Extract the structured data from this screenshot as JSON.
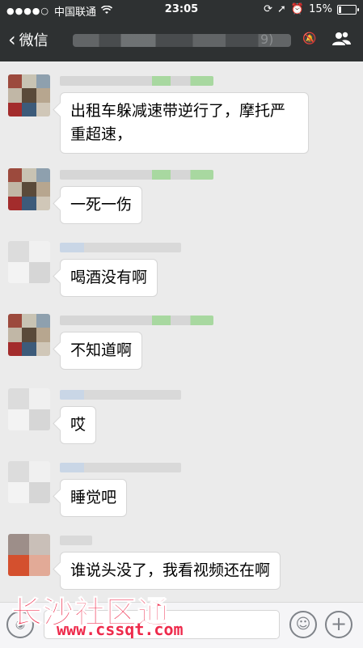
{
  "status": {
    "signal": "●●●●○",
    "carrier": "中国联通",
    "wifi_icon": "wifi-icon",
    "time": "23:05",
    "battery": "15%",
    "battery_level": 0.15
  },
  "nav": {
    "back_label": "微信",
    "title_visible_suffix": "9)"
  },
  "messages": [
    {
      "avatar": "mosaic",
      "name_style": "a",
      "text": "出租车躲减速带逆行了，摩托严重超速，"
    },
    {
      "avatar": "mosaic",
      "name_style": "a",
      "text": "一死一伤"
    },
    {
      "avatar": "light",
      "name_style": "b",
      "text": "喝酒没有啊"
    },
    {
      "avatar": "mosaic",
      "name_style": "a",
      "text": "不知道啊"
    },
    {
      "avatar": "light",
      "name_style": "b",
      "text": "哎"
    },
    {
      "avatar": "light",
      "name_style": "b",
      "text": "睡觉吧"
    },
    {
      "avatar": "orange",
      "name_style": "c",
      "text": "谁说头没了，我看视频还在啊"
    }
  ],
  "watermark": {
    "logo": "长沙社区通",
    "url": "www.cssqt.com"
  }
}
